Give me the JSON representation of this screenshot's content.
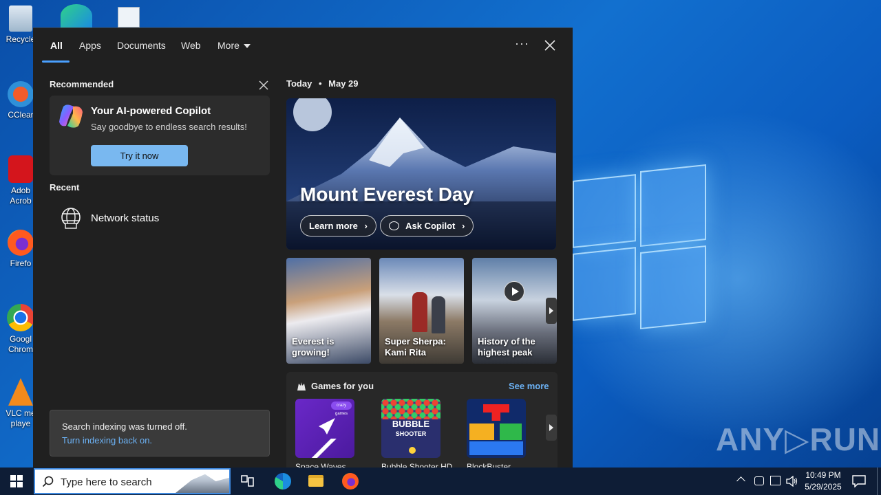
{
  "desktop": {
    "icons": [
      {
        "name": "recycle",
        "label": "Recycle"
      },
      {
        "name": "ccleaner",
        "label": "CClear"
      },
      {
        "name": "adobe",
        "label": "Adob Acrob"
      },
      {
        "name": "firefox",
        "label": "Firefo"
      },
      {
        "name": "chrome",
        "label": "Googl Chrom"
      },
      {
        "name": "vlc",
        "label": "VLC me playe"
      }
    ],
    "watermark": "ANY▷RUN"
  },
  "search_panel": {
    "tabs": [
      {
        "label": "All",
        "active": true
      },
      {
        "label": "Apps"
      },
      {
        "label": "Documents"
      },
      {
        "label": "Web"
      },
      {
        "label": "More"
      }
    ],
    "options_icon": "more-options-icon",
    "close_icon": "close-icon",
    "recommended": {
      "heading": "Recommended",
      "card_title": "Your AI-powered Copilot",
      "card_subtitle": "Say goodbye to endless search results!",
      "button": "Try it now"
    },
    "recent": {
      "heading": "Recent",
      "items": [
        {
          "label": "Network status",
          "icon": "globe-network-icon"
        }
      ]
    },
    "indexing": {
      "message": "Search indexing was turned off.",
      "link": "Turn indexing back on."
    },
    "today": {
      "label": "Today",
      "separator": "•",
      "date": "May 29",
      "hero_title": "Mount Everest Day",
      "learn_more": "Learn more",
      "ask_copilot": "Ask Copilot",
      "thumbs": [
        {
          "title": "Everest is growing!"
        },
        {
          "title": "Super Sherpa: Kami Rita"
        },
        {
          "title": "History of the highest peak"
        }
      ]
    },
    "games": {
      "heading": "Games for you",
      "see_more": "See more",
      "items": [
        {
          "name": "Space Waves"
        },
        {
          "name": "Bubble Shooter HD"
        },
        {
          "name": "BlockBuster"
        }
      ],
      "bubble_logo_line1": "BUBBLE",
      "bubble_logo_line2": "SHOOTER",
      "crazy_badge": "crazy games"
    }
  },
  "taskbar": {
    "search_placeholder": "Type here to search",
    "time": "10:49 PM",
    "date": "5/29/2025"
  }
}
